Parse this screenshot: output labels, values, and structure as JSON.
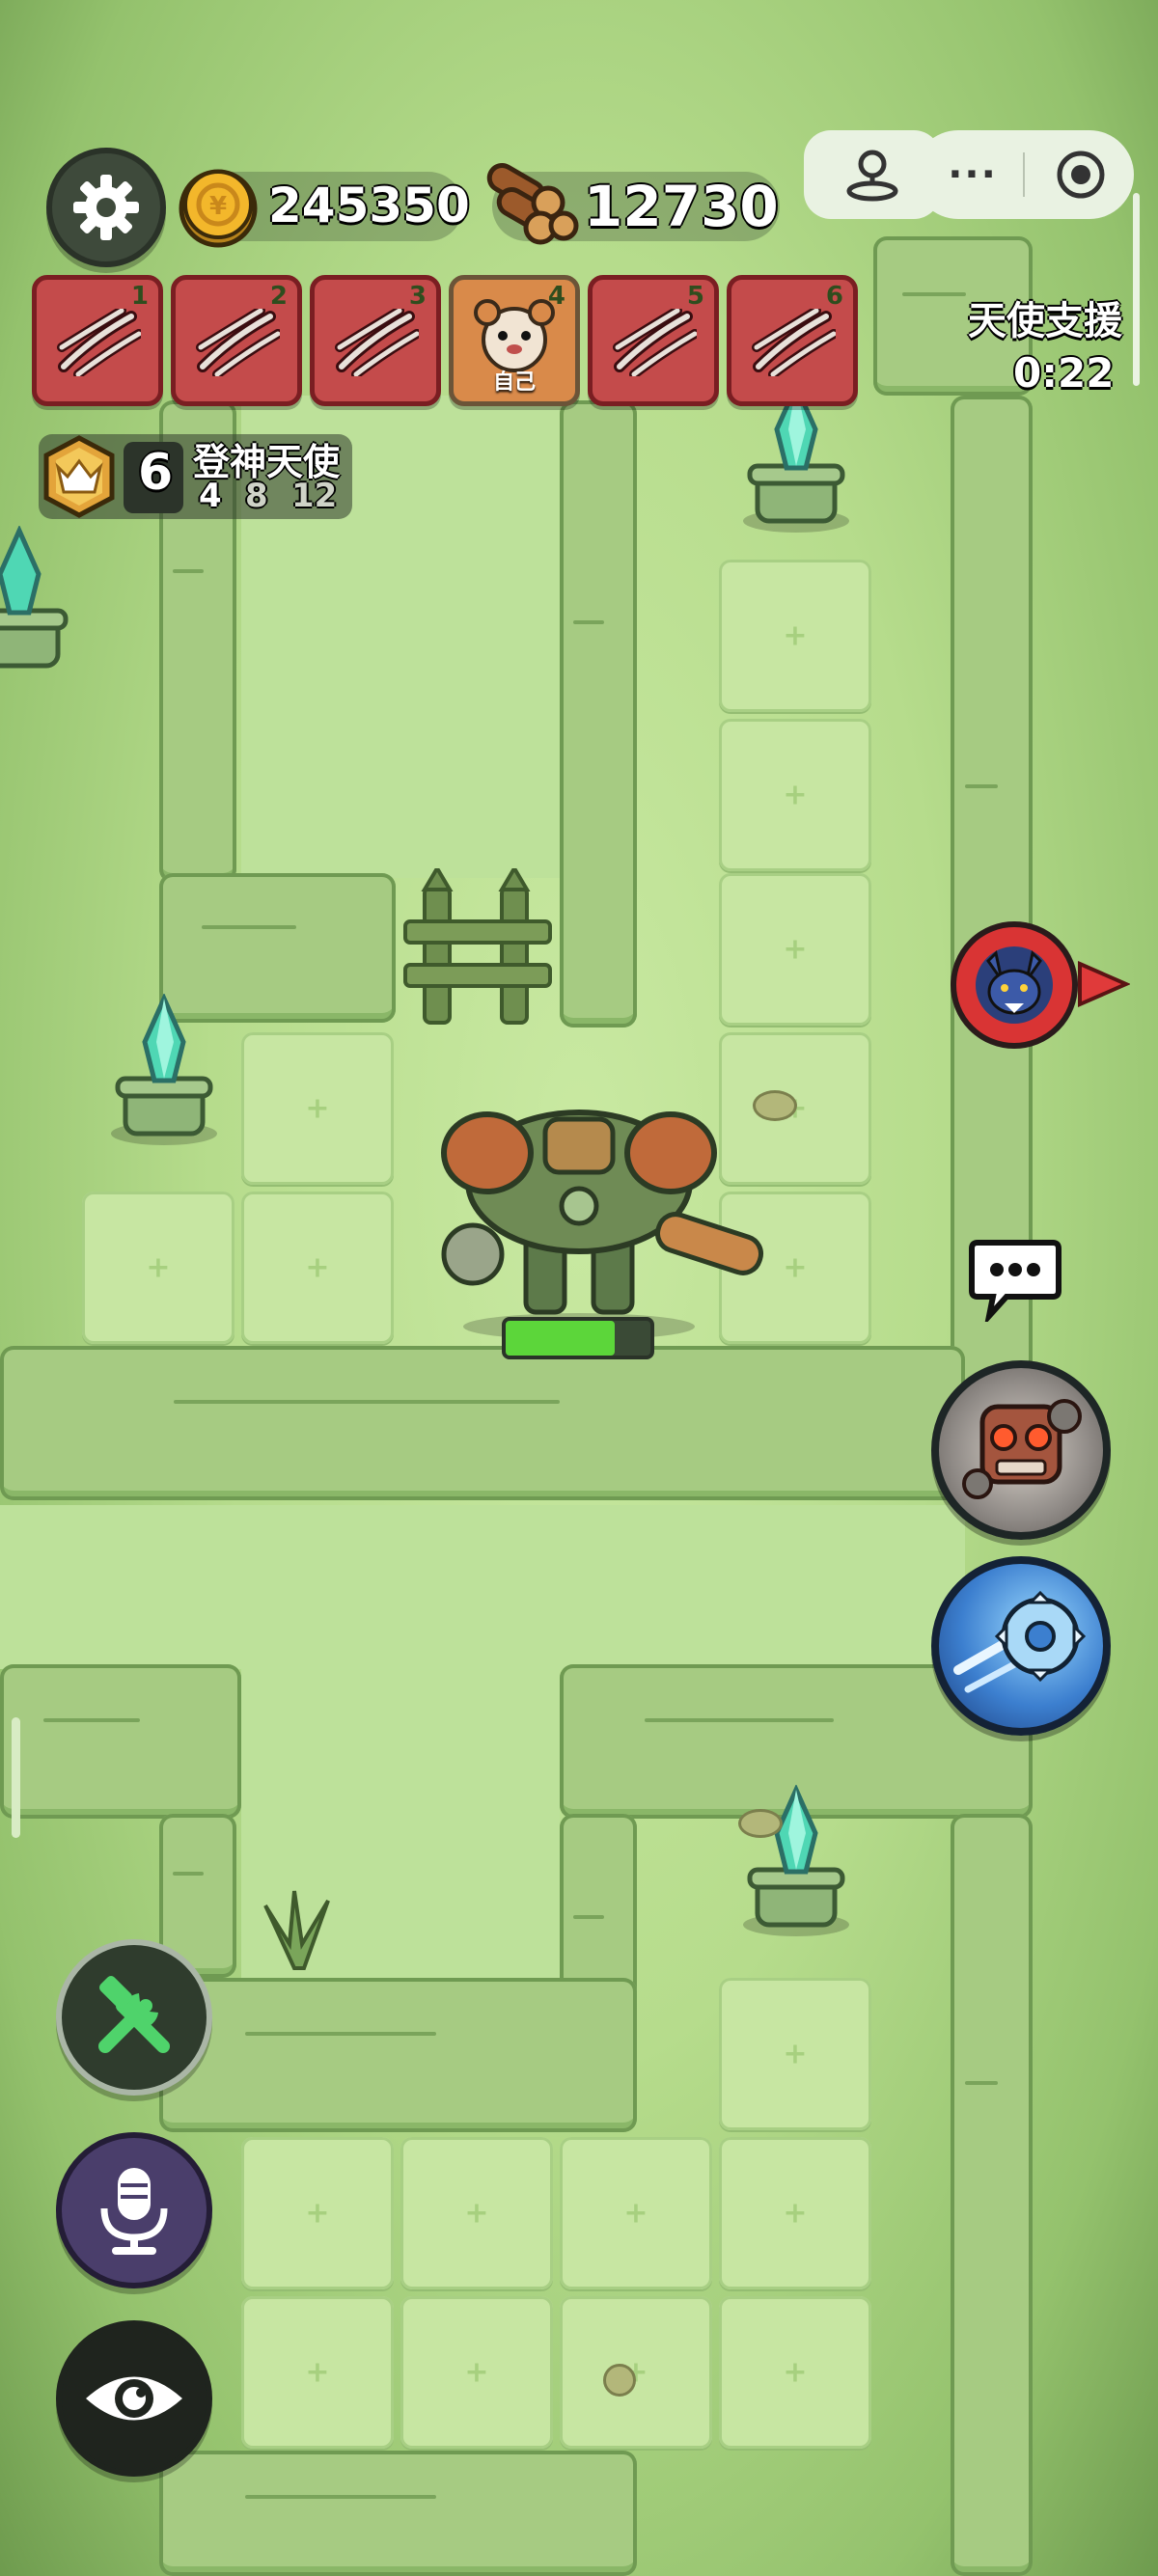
{
  "resources": {
    "gold": "245350",
    "wood": "12730"
  },
  "cards": [
    {
      "num": "1",
      "self": false
    },
    {
      "num": "2",
      "self": false
    },
    {
      "num": "3",
      "self": false
    },
    {
      "num": "4",
      "self": true,
      "label": "自己"
    },
    {
      "num": "5",
      "self": false
    },
    {
      "num": "6",
      "self": false
    }
  ],
  "rank": {
    "level": "6",
    "title": "登神天使",
    "milestones": [
      "4",
      "8",
      "12"
    ]
  },
  "support": {
    "label": "天使支援",
    "timer": "0:22"
  },
  "boss": {
    "health_fraction": 0.75
  },
  "icons": {
    "settings": "gear-icon",
    "gold": "gold-coin-icon",
    "wood": "wood-logs-icon",
    "profile": "profile-icon",
    "more": "more-dots-icon",
    "record": "record-circle-icon",
    "rank": "angel-badge-icon",
    "enemy": "wolf-enemy-icon",
    "chat": "chat-bubble-icon",
    "skill1": "robot-skull-skill-icon",
    "skill2": "saw-blade-skill-icon",
    "build": "build-tools-icon",
    "mic": "microphone-icon",
    "view": "eye-icon"
  },
  "colors": {
    "card_red": "#c44b4b",
    "hp_green": "#5cd63a",
    "ui_dark": "#3e4a3b"
  }
}
